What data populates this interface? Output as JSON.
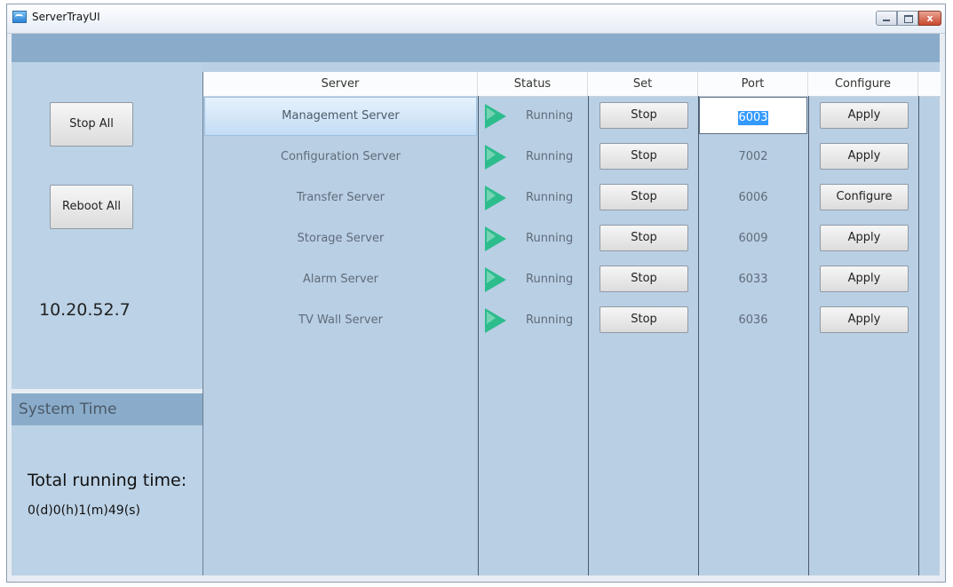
{
  "window": {
    "title": "ServerTrayUI",
    "close_glyph": "x"
  },
  "left": {
    "stop_all_label": "Stop All",
    "reboot_all_label": "Reboot All",
    "ip": "10.20.52.7"
  },
  "time": {
    "header": "System Time",
    "total_label": "Total running time:",
    "total_value": "0(d)0(h)1(m)49(s)"
  },
  "table": {
    "columns": [
      "Server",
      "Status",
      "Set",
      "Port",
      "Configure"
    ],
    "rows": [
      {
        "server": "Management Server",
        "status": "Running",
        "set": "Stop",
        "port": "6003",
        "configure": "Apply"
      },
      {
        "server": "Configuration Server",
        "status": "Running",
        "set": "Stop",
        "port": "7002",
        "configure": "Apply"
      },
      {
        "server": "Transfer Server",
        "status": "Running",
        "set": "Stop",
        "port": "6006",
        "configure": "Configure"
      },
      {
        "server": "Storage Server",
        "status": "Running",
        "set": "Stop",
        "port": "6009",
        "configure": "Apply"
      },
      {
        "server": "Alarm Server",
        "status": "Running",
        "set": "Stop",
        "port": "6033",
        "configure": "Apply"
      },
      {
        "server": "TV Wall Server",
        "status": "Running",
        "set": "Stop",
        "port": "6036",
        "configure": "Apply"
      }
    ]
  },
  "colors": {
    "running_icon": "#2dbd8d",
    "panel_bg": "#bcd2e6",
    "header_bar": "#8aacca"
  }
}
